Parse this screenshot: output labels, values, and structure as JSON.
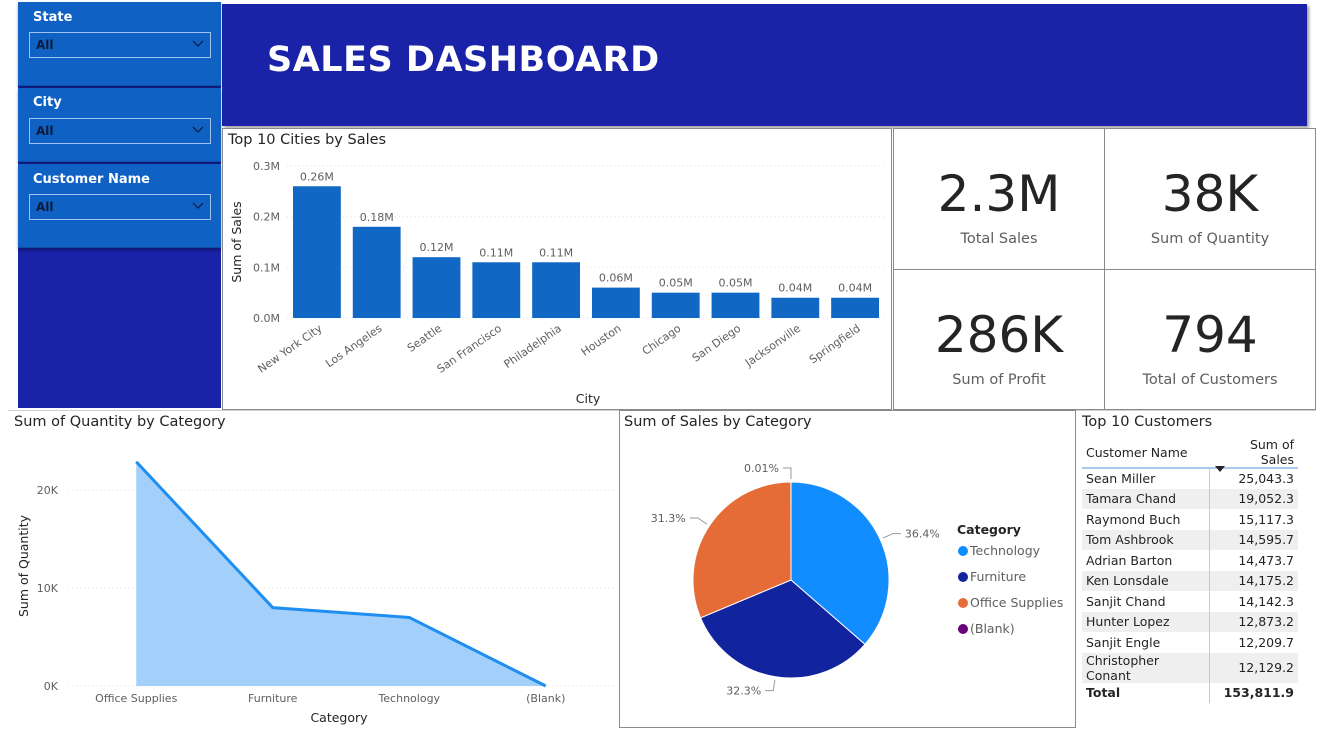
{
  "header": {
    "title": "SALES DASHBOARD"
  },
  "slicers": [
    {
      "label": "State",
      "value": "All"
    },
    {
      "label": "City",
      "value": "All"
    },
    {
      "label": "Customer Name",
      "value": "All"
    }
  ],
  "kpis": [
    {
      "value": "2.3M",
      "label": "Total Sales"
    },
    {
      "value": "38K",
      "label": "Sum of Quantity"
    },
    {
      "value": "286K",
      "label": "Sum of Profit"
    },
    {
      "value": "794",
      "label": "Total of Customers"
    }
  ],
  "top_customers": {
    "title": "Top 10 Customers",
    "columns": [
      "Customer Name",
      "Sum of Sales"
    ],
    "rows": [
      [
        "Sean Miller",
        "25,043.3"
      ],
      [
        "Tamara Chand",
        "19,052.3"
      ],
      [
        "Raymond Buch",
        "15,117.3"
      ],
      [
        "Tom Ashbrook",
        "14,595.7"
      ],
      [
        "Adrian Barton",
        "14,473.7"
      ],
      [
        "Ken Lonsdale",
        "14,175.2"
      ],
      [
        "Sanjit Chand",
        "14,142.3"
      ],
      [
        "Hunter Lopez",
        "12,873.2"
      ],
      [
        "Sanjit Engle",
        "12,209.7"
      ],
      [
        "Christopher Conant",
        "12,129.2"
      ]
    ],
    "total_label": "Total",
    "total_value": "153,811.9"
  },
  "chart_data": [
    {
      "type": "bar",
      "title": "Top 10 Cities by Sales",
      "xlabel": "City",
      "ylabel": "Sum of Sales",
      "categories": [
        "New York City",
        "Los Angeles",
        "Seattle",
        "San Francisco",
        "Philadelphia",
        "Houston",
        "Chicago",
        "San Diego",
        "Jacksonville",
        "Springfield"
      ],
      "values": [
        0.26,
        0.18,
        0.12,
        0.11,
        0.11,
        0.06,
        0.05,
        0.05,
        0.04,
        0.04
      ],
      "data_labels": [
        "0.26M",
        "0.18M",
        "0.12M",
        "0.11M",
        "0.11M",
        "0.06M",
        "0.05M",
        "0.05M",
        "0.04M",
        "0.04M"
      ],
      "yticks": [
        0,
        0.1,
        0.2,
        0.3
      ],
      "ytick_labels": [
        "0.0M",
        "0.1M",
        "0.2M",
        "0.3M"
      ],
      "ylim": [
        0,
        0.3
      ],
      "color": "#1167c4",
      "grid": true
    },
    {
      "type": "area",
      "title": "Sum of Quantity by Category",
      "xlabel": "Category",
      "ylabel": "Sum of Quantity",
      "categories": [
        "Office Supplies",
        "Furniture",
        "Technology",
        "(Blank)"
      ],
      "values": [
        22900,
        8000,
        7000,
        0
      ],
      "yticks": [
        0,
        10000,
        20000
      ],
      "ytick_labels": [
        "0K",
        "10K",
        "20K"
      ],
      "ylim": [
        0,
        24000
      ],
      "line_color": "#1e8ff0",
      "fill_color": "#a3d0fa",
      "grid": true
    },
    {
      "type": "pie",
      "title": "Sum of Sales by Category",
      "legend_title": "Category",
      "legend_position": "right",
      "slices": [
        {
          "name": "Technology",
          "value": 36.4,
          "label": "36.4%",
          "color": "#118dff"
        },
        {
          "name": "Furniture",
          "value": 32.3,
          "label": "32.3%",
          "color": "#12239e"
        },
        {
          "name": "Office Supplies",
          "value": 31.3,
          "label": "31.3%",
          "color": "#e66c37"
        },
        {
          "name": "(Blank)",
          "value": 0.01,
          "label": "0.01%",
          "color": "#6b007b"
        }
      ]
    }
  ]
}
